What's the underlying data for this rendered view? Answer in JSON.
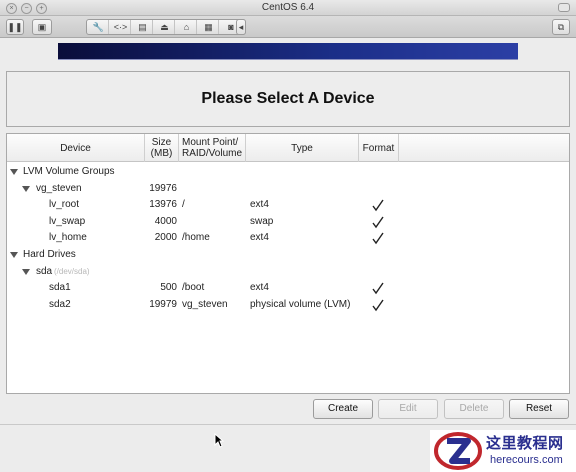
{
  "window": {
    "title": "CentOS 6.4"
  },
  "header": {
    "title": "Please Select A Device"
  },
  "columns": {
    "device": "Device",
    "size_line1": "Size",
    "size_line2": "(MB)",
    "mount_line1": "Mount Point/",
    "mount_line2": "RAID/Volume",
    "type": "Type",
    "format": "Format"
  },
  "rows": [
    {
      "device": "LVM Volume Groups",
      "size": "",
      "mount": "",
      "type": "",
      "format": false,
      "level": 0,
      "expander": true
    },
    {
      "device": "vg_steven",
      "size": "19976",
      "mount": "",
      "type": "",
      "format": false,
      "level": 1,
      "expander": true
    },
    {
      "device": "lv_root",
      "size": "13976",
      "mount": "/",
      "type": "ext4",
      "format": true,
      "level": 2,
      "expander": false
    },
    {
      "device": "lv_swap",
      "size": "4000",
      "mount": "",
      "type": "swap",
      "format": true,
      "level": 2,
      "expander": false
    },
    {
      "device": "lv_home",
      "size": "2000",
      "mount": "/home",
      "type": "ext4",
      "format": true,
      "level": 2,
      "expander": false
    },
    {
      "device": "Hard Drives",
      "size": "",
      "mount": "",
      "type": "",
      "format": false,
      "level": 0,
      "expander": true
    },
    {
      "device": "sda",
      "path": "(/dev/sda)",
      "size": "",
      "mount": "",
      "type": "",
      "format": false,
      "level": 1,
      "expander": true
    },
    {
      "device": "sda1",
      "size": "500",
      "mount": "/boot",
      "type": "ext4",
      "format": true,
      "level": 2,
      "expander": false
    },
    {
      "device": "sda2",
      "size": "19979",
      "mount": "vg_steven",
      "type": "physical volume (LVM)",
      "format": true,
      "level": 2,
      "expander": false
    }
  ],
  "buttons": {
    "create": "Create",
    "edit": "Edit",
    "delete": "Delete",
    "reset": "Reset"
  },
  "watermark": {
    "cn": "这里教程网",
    "en": "herecours.com"
  },
  "colors": {
    "banner_dark": "#0a0d3a",
    "banner_light": "#2c3fa5",
    "watermark": "#2a2f8f"
  }
}
